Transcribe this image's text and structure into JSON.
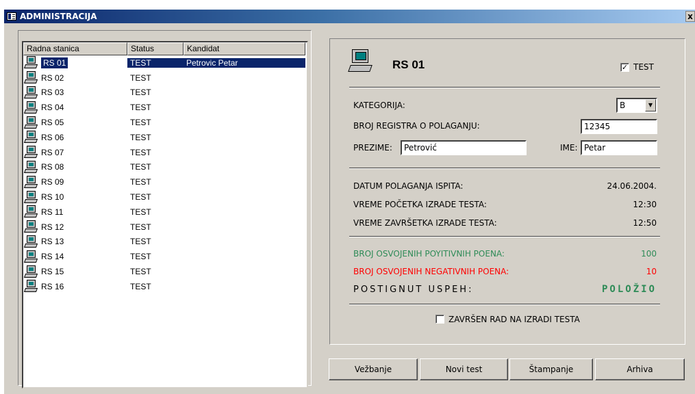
{
  "window": {
    "title": "ADMINISTRACIJA",
    "close_label": "x"
  },
  "list": {
    "columns": [
      "Radna stanica",
      "Status",
      "Kandidat"
    ],
    "rows": [
      {
        "station": "RS 01",
        "status": "TEST",
        "candidate": "Petrovic Petar",
        "selected": true
      },
      {
        "station": "RS 02",
        "status": "TEST",
        "candidate": ""
      },
      {
        "station": "RS 03",
        "status": "TEST",
        "candidate": ""
      },
      {
        "station": "RS 04",
        "status": "TEST",
        "candidate": ""
      },
      {
        "station": "RS 05",
        "status": "TEST",
        "candidate": ""
      },
      {
        "station": "RS 06",
        "status": "TEST",
        "candidate": ""
      },
      {
        "station": "RS 07",
        "status": "TEST",
        "candidate": ""
      },
      {
        "station": "RS 08",
        "status": "TEST",
        "candidate": ""
      },
      {
        "station": "RS 09",
        "status": "TEST",
        "candidate": ""
      },
      {
        "station": "RS 10",
        "status": "TEST",
        "candidate": ""
      },
      {
        "station": "RS 11",
        "status": "TEST",
        "candidate": ""
      },
      {
        "station": "RS 12",
        "status": "TEST",
        "candidate": ""
      },
      {
        "station": "RS 13",
        "status": "TEST",
        "candidate": ""
      },
      {
        "station": "RS 14",
        "status": "TEST",
        "candidate": ""
      },
      {
        "station": "RS 15",
        "status": "TEST",
        "candidate": ""
      },
      {
        "station": "RS 16",
        "status": "TEST",
        "candidate": ""
      }
    ]
  },
  "detail": {
    "station_title": "RS 01",
    "test_checkbox": {
      "label": "TEST",
      "checked": true,
      "mark": "✓"
    },
    "kategorija": {
      "label": "KATEGORIJA:",
      "value": "B",
      "arrow": "▼"
    },
    "broj_registra": {
      "label": "BROJ REGISTRA O POLAGANJU:",
      "value": "12345"
    },
    "prezime": {
      "label": "PREZIME:",
      "value": "Petrović"
    },
    "ime": {
      "label": "IME:",
      "value": "Petar"
    },
    "datum": {
      "label": "DATUM POLAGANJA ISPITA:",
      "value": "24.06.2004."
    },
    "vreme_pocetka": {
      "label": "VREME POČETKA IZRADE TESTA:",
      "value": "12:30"
    },
    "vreme_zavrsetka": {
      "label": "VREME ZAVRŠETKA IZRADE TESTA:",
      "value": "12:50"
    },
    "pozitivni": {
      "label": "BROJ OSVOJENIH POYITIVNIH POENA:",
      "value": "100",
      "color": "#2e8b57"
    },
    "negativni": {
      "label": "BROJ OSVOJENIH NEGATIVNIH POENA:",
      "value": "10",
      "color": "#ff0000"
    },
    "uspeh": {
      "label": "POSTIGNUT USPEH:",
      "value": "POLOŽIO"
    },
    "zavrsen": {
      "label": "ZAVRŠEN RAD NA IZRADI TESTA",
      "checked": false
    }
  },
  "buttons": {
    "vezbanje": "Vežbanje",
    "novi_test": "Novi test",
    "stampanje": "Štampanje",
    "arhiva": "Arhiva"
  },
  "colors": {
    "title_bar": "#0a246a",
    "face": "#d4d0c8",
    "selection": "#0a246a"
  }
}
